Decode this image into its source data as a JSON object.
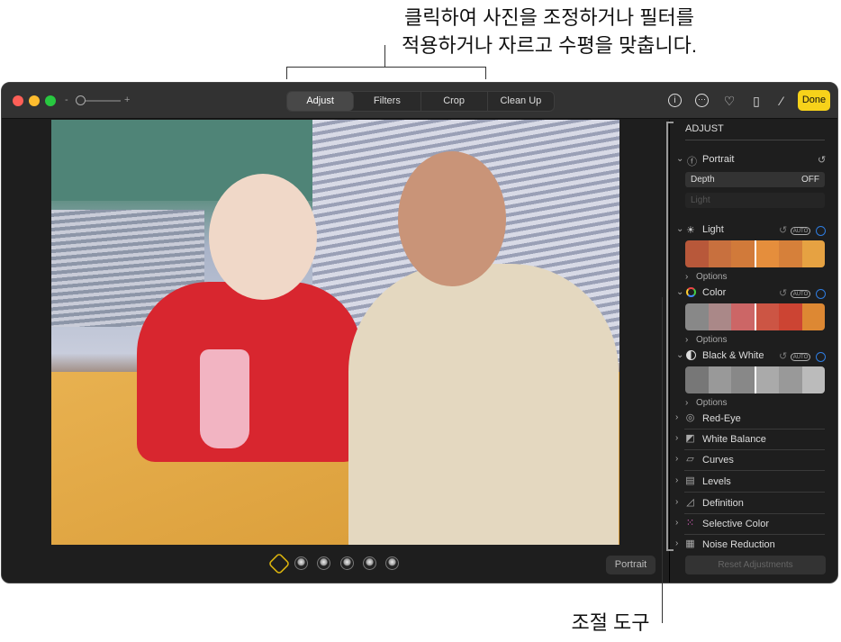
{
  "callouts": {
    "top_line1": "클릭하여 사진을 조정하거나 필터를",
    "top_line2": "적용하거나 자르고 수평을 맞춥니다.",
    "right": "조절 도구"
  },
  "toolbar": {
    "zoom_minus": "-",
    "zoom_plus": "+",
    "tabs": [
      "Adjust",
      "Filters",
      "Crop",
      "Clean Up"
    ],
    "active_tab": "Adjust",
    "icons": [
      "info-icon",
      "more-icon",
      "heart-icon",
      "rotate-icon",
      "magic-wand-icon"
    ],
    "done": "Done",
    "done_color": "#f7d21a"
  },
  "sidebar": {
    "title": "ADJUST",
    "portrait": {
      "label": "Portrait",
      "depth_label": "Depth",
      "depth_value": "OFF",
      "light_label": "Light"
    },
    "sections": [
      {
        "label": "Light",
        "auto": "AUTO",
        "options": "Options"
      },
      {
        "label": "Color",
        "auto": "AUTO",
        "options": "Options"
      },
      {
        "label": "Black & White",
        "auto": "AUTO",
        "options": "Options"
      }
    ],
    "rows": [
      "Red-Eye",
      "White Balance",
      "Curves",
      "Levels",
      "Definition",
      "Selective Color",
      "Noise Reduction"
    ],
    "reset": "Reset Adjustments",
    "accent": "#2f7de1"
  },
  "bottom": {
    "portrait_button": "Portrait"
  }
}
